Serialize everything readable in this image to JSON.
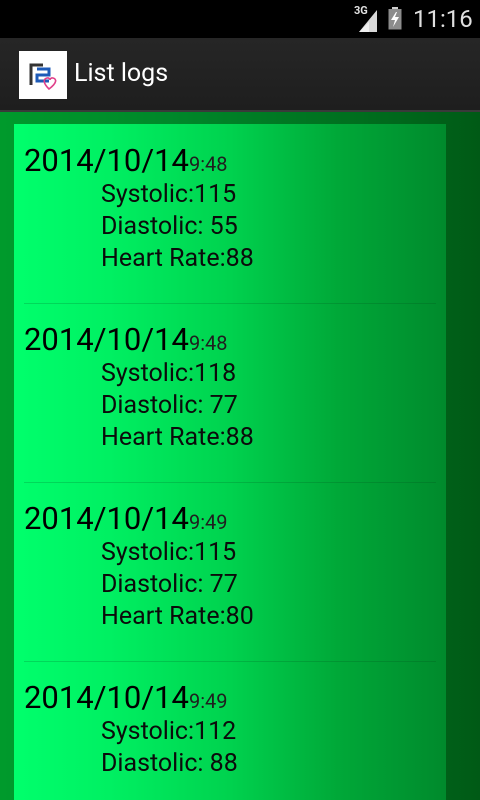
{
  "status_bar": {
    "network": "3G",
    "clock": "11:16"
  },
  "action_bar": {
    "title": "List logs",
    "icon": "app-logo-heart-icon"
  },
  "entries": [
    {
      "date": "2014/10/14",
      "time": "9:48",
      "systolic": "Systolic:115",
      "diastolic": "Diastolic: 55",
      "heart_rate": "Heart Rate:88"
    },
    {
      "date": "2014/10/14",
      "time": "9:48",
      "systolic": "Systolic:118",
      "diastolic": "Diastolic: 77",
      "heart_rate": "Heart Rate:88"
    },
    {
      "date": "2014/10/14",
      "time": "9:49",
      "systolic": "Systolic:115",
      "diastolic": "Diastolic: 77",
      "heart_rate": "Heart Rate:80"
    },
    {
      "date": "2014/10/14",
      "time": "9:49",
      "systolic": "Systolic:112",
      "diastolic": "Diastolic: 88",
      "heart_rate": ""
    }
  ]
}
